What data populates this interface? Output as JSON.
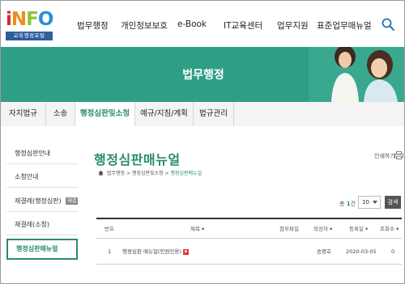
{
  "logo": {
    "letters": [
      "i",
      "N",
      "F",
      "O"
    ],
    "subtitle": "교육행정포털"
  },
  "nav": {
    "items": [
      "법무행정",
      "개인정보보호",
      "e-Book",
      "IT교육센터",
      "업무지원",
      "표준업무매뉴얼"
    ],
    "search_icon": "search-icon"
  },
  "banner": {
    "title": "법무행정"
  },
  "tabs": {
    "items": [
      "자치법규",
      "소송",
      "행정심판및소청",
      "예규/지침/계획",
      "법규관리"
    ],
    "active_index": 2
  },
  "sidebar": {
    "items": [
      {
        "label": "행정심판안내"
      },
      {
        "label": "소청안내"
      },
      {
        "label": "재결례(행정심판)",
        "badge": "재결"
      },
      {
        "label": "재결례(소청)"
      },
      {
        "label": "행정심판매뉴얼",
        "active": true
      }
    ]
  },
  "main": {
    "title": "행정심판매뉴얼",
    "print_label": "인쇄하기",
    "breadcrumb": [
      "법무행정",
      "행정심판및소청",
      "행정심판매뉴얼"
    ],
    "total_prefix": "총",
    "total_count": "1",
    "total_suffix": "건",
    "page_size": "10",
    "go_label": "검색"
  },
  "table": {
    "headers": [
      "번호",
      "제목 ▾",
      "첨부파일",
      "작성자 ▾",
      "등록일 ▾",
      "조회수 ▾"
    ],
    "rows": [
      {
        "no": "1",
        "title": "행정심판 매뉴얼(민원인용)",
        "attachment": "",
        "author": "송명호",
        "date": "2020-03-05",
        "views": "0"
      }
    ]
  },
  "colors": {
    "accent": "#2a8c72",
    "banner": "#2f9e86"
  }
}
